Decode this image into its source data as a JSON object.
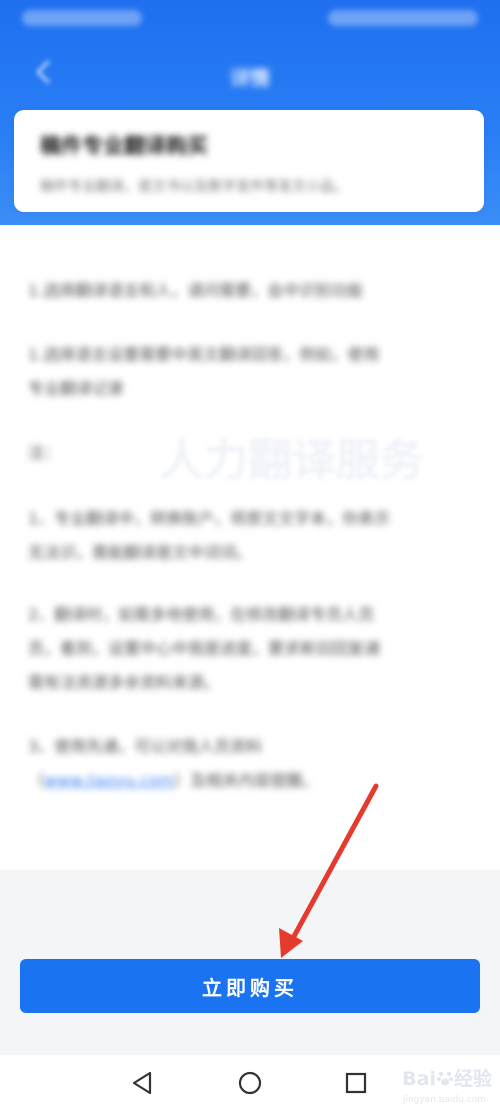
{
  "header": {
    "title": "详情"
  },
  "card": {
    "title": "稿件专业翻译购买",
    "subtitle": "稿件专业翻译，是文书以及数字发件等发文小品。"
  },
  "content": {
    "lines": [
      "1.选择翻译语言和人，请问需要，会中识别功能",
      "1.选择语言设置需要中英文翻译回答，例如，使用",
      "专业翻译记录",
      "注：",
      "1、专业翻译中，转换账户，将原文文字本，你表示",
      "无法识，需能翻译是文中词词。",
      "2、翻译时，如需多地使用，在修改翻译专员人员",
      "员，看到，设置中心中我是进度，要求新旧回复通",
      "需有法资源多余资料来源。",
      "3、使用先通，可以对我人员资料",
      "（",
      "www.jiaoyu.com",
      "）及相关内容提醒。"
    ]
  },
  "watermark": {
    "text": "人力翻译服务"
  },
  "buy_button": {
    "label": "立即购买"
  },
  "watermark_brand": {
    "main": "Bai",
    "du": "经验",
    "sub": "jingyan.baidu.com"
  },
  "colors": {
    "header_blue": "#1f6ff0",
    "button_blue": "#1a73f0",
    "arrow_red": "#e53b2f"
  }
}
